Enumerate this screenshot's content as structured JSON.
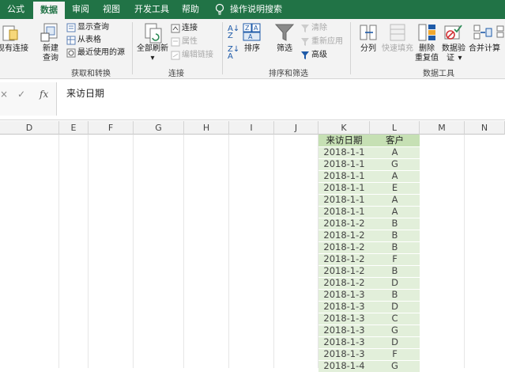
{
  "tabs": [
    {
      "label": "公式",
      "active": false
    },
    {
      "label": "数据",
      "active": true
    },
    {
      "label": "审阅",
      "active": false
    },
    {
      "label": "视图",
      "active": false
    },
    {
      "label": "开发工具",
      "active": false
    },
    {
      "label": "帮助",
      "active": false
    }
  ],
  "tell_me": "操作说明搜索",
  "ribbon": {
    "get_transform": {
      "existing_conn": "现有连接",
      "new_query_1": "新建",
      "new_query_2": "查询",
      "show_query": "显示查询",
      "from_table": "从表格",
      "recent_sources": "最近使用的源",
      "label": "获取和转换"
    },
    "connections": {
      "refresh_all": "全部刷新",
      "connections": "连接",
      "properties": "属性",
      "edit_links": "编辑链接",
      "label": "连接"
    },
    "sort_filter": {
      "sort": "排序",
      "filter": "筛选",
      "clear": "清除",
      "reapply": "重新应用",
      "advanced": "高级",
      "label": "排序和筛选"
    },
    "data_tools": {
      "text_to_columns": "分列",
      "flash_fill": "快速填充",
      "remove_dup_1": "删除",
      "remove_dup_2": "重复值",
      "validation_1": "数据验",
      "validation_2": "证",
      "consolidate": "合并计算",
      "label": "数据工具"
    }
  },
  "formula_bar": {
    "cancel": "×",
    "enter": "✓",
    "fx": "fx",
    "content": "来访日期"
  },
  "columns": [
    "D",
    "E",
    "F",
    "G",
    "H",
    "I",
    "J",
    "K",
    "L",
    "M",
    "N"
  ],
  "table": {
    "headers": [
      "来访日期",
      "客户"
    ],
    "rows": [
      [
        "2018-1-1",
        "A"
      ],
      [
        "2018-1-1",
        "G"
      ],
      [
        "2018-1-1",
        "A"
      ],
      [
        "2018-1-1",
        "E"
      ],
      [
        "2018-1-1",
        "A"
      ],
      [
        "2018-1-1",
        "A"
      ],
      [
        "2018-1-2",
        "B"
      ],
      [
        "2018-1-2",
        "B"
      ],
      [
        "2018-1-2",
        "B"
      ],
      [
        "2018-1-2",
        "F"
      ],
      [
        "2018-1-2",
        "B"
      ],
      [
        "2018-1-2",
        "D"
      ],
      [
        "2018-1-3",
        "B"
      ],
      [
        "2018-1-3",
        "D"
      ],
      [
        "2018-1-3",
        "C"
      ],
      [
        "2018-1-3",
        "G"
      ],
      [
        "2018-1-3",
        "D"
      ],
      [
        "2018-1-3",
        "F"
      ],
      [
        "2018-1-4",
        "G"
      ]
    ],
    "header_color": "#c6e0b4",
    "band_color": "#e2efda"
  },
  "colors": {
    "accent": "#217346"
  }
}
